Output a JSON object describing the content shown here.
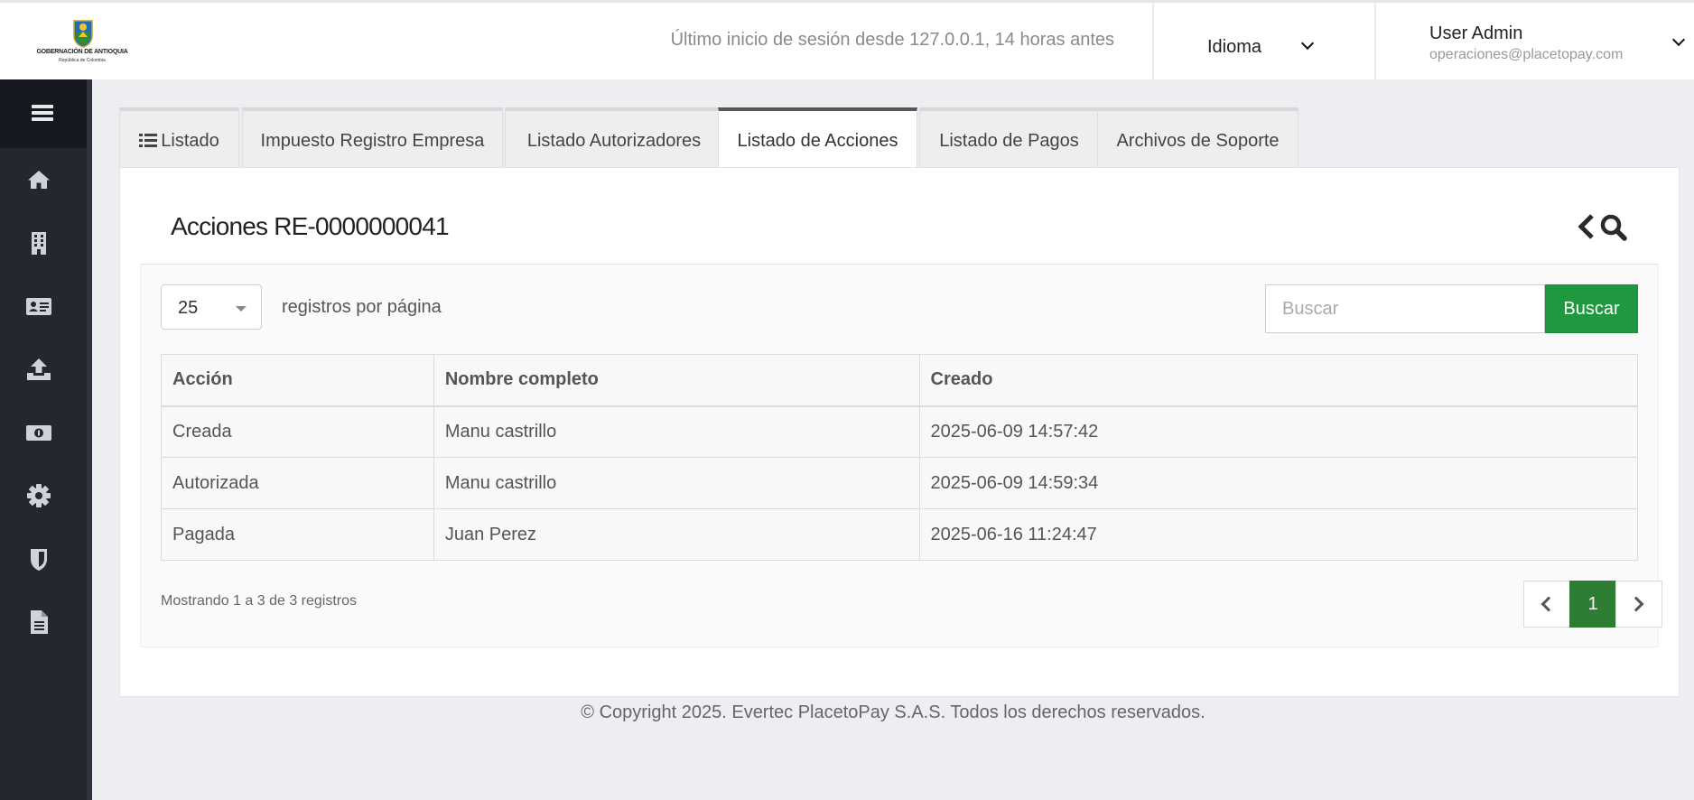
{
  "header": {
    "logo_title": "GOBERNACIÓN DE ANTIOQUIA",
    "logo_subtitle": "República de Colombia",
    "last_login": "Último inicio de sesión desde 127.0.0.1, 14 horas antes",
    "language_label": "Idioma",
    "user_name": "User Admin",
    "user_email": "operaciones@placetopay.com"
  },
  "sidebar": {
    "items": [
      {
        "icon": "home-icon"
      },
      {
        "icon": "building-icon"
      },
      {
        "icon": "id-card-icon"
      },
      {
        "icon": "upload-icon"
      },
      {
        "icon": "money-icon"
      },
      {
        "icon": "gear-icon"
      },
      {
        "icon": "shield-icon"
      },
      {
        "icon": "document-icon"
      }
    ]
  },
  "tabs": [
    {
      "label": "Listado",
      "active": false
    },
    {
      "label": "Impuesto Registro Empresa",
      "active": false
    },
    {
      "label": "Listado Autorizadores",
      "active": false
    },
    {
      "label": "Listado de Acciones",
      "active": true
    },
    {
      "label": "Listado de Pagos",
      "active": false
    },
    {
      "label": "Archivos de Soporte",
      "active": false
    }
  ],
  "panel": {
    "title": "Acciones RE-0000000041",
    "page_length": "25",
    "page_length_label": "registros por página",
    "search_placeholder": "Buscar",
    "search_button": "Buscar",
    "columns": [
      "Acción",
      "Nombre completo",
      "Creado"
    ],
    "rows": [
      [
        "Creada",
        "Manu castrillo",
        "2025-06-09 14:57:42"
      ],
      [
        "Autorizada",
        "Manu castrillo",
        "2025-06-09 14:59:34"
      ],
      [
        "Pagada",
        "Juan Perez",
        "2025-06-16 11:24:47"
      ]
    ],
    "info": "Mostrando 1 a 3 de 3 registros",
    "current_page": "1"
  },
  "footer": {
    "copyright": "© Copyright 2025. Evertec PlacetoPay S.A.S. Todos los derechos reservados."
  },
  "colors": {
    "sidebar": "#222730",
    "accent_green": "#1f9840",
    "pagination_active": "#2e7d32"
  }
}
